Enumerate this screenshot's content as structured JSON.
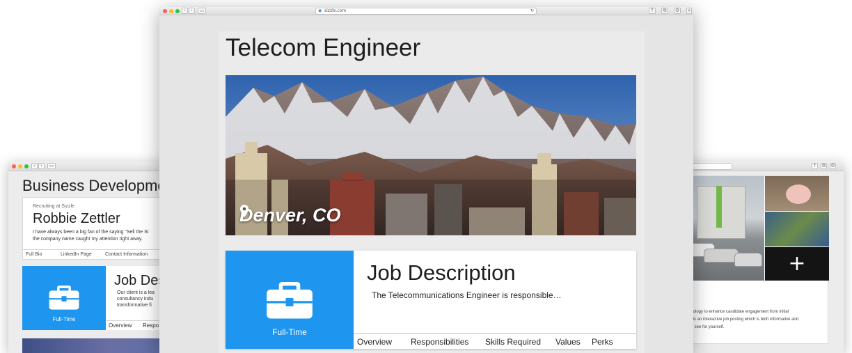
{
  "main_window": {
    "url": "sizzle.com",
    "page_title": "Telecom Engineer",
    "location": "Denver, CO",
    "job_card": {
      "type": "Full-Time",
      "title": "Job Description",
      "description": "The Telecommunications Engineer is responsible…",
      "tabs": [
        "Overview",
        "Responsibilities",
        "Skills Required",
        "Values",
        "Perks"
      ]
    }
  },
  "left_window": {
    "page_title": "Business Developme",
    "recruiter_label": "Recruiting at Sizzle",
    "recruiter_name": "Robbie Zettler",
    "quote_line1": "I have always been a big fan of the saying \"Sell the Si",
    "quote_line2": "the company name caught my attention right away.",
    "links": [
      "Full Bio",
      "LinkedIn Page",
      "Contact Information"
    ],
    "job_card": {
      "type": "Full-Time",
      "title": "Job Des",
      "desc_line1": "Our client is a lea",
      "desc_line2": "consultancy indu",
      "desc_line3": "transformative fi",
      "tabs": [
        "Overview",
        "Respo"
      ]
    }
  },
  "right_window": {
    "add_glyph": "+",
    "text_line1": "technology to enhance candidate engagement from initial",
    "text_line2": "- this is an interactive job posting which is both informative and",
    "text_line3": "d and see for yourself."
  },
  "colors": {
    "accent_blue": "#1e95ee",
    "page_bg": "#ebebeb"
  },
  "icons": {
    "location": "map-pin-icon",
    "job_type": "briefcase-icon",
    "add": "plus-icon"
  }
}
